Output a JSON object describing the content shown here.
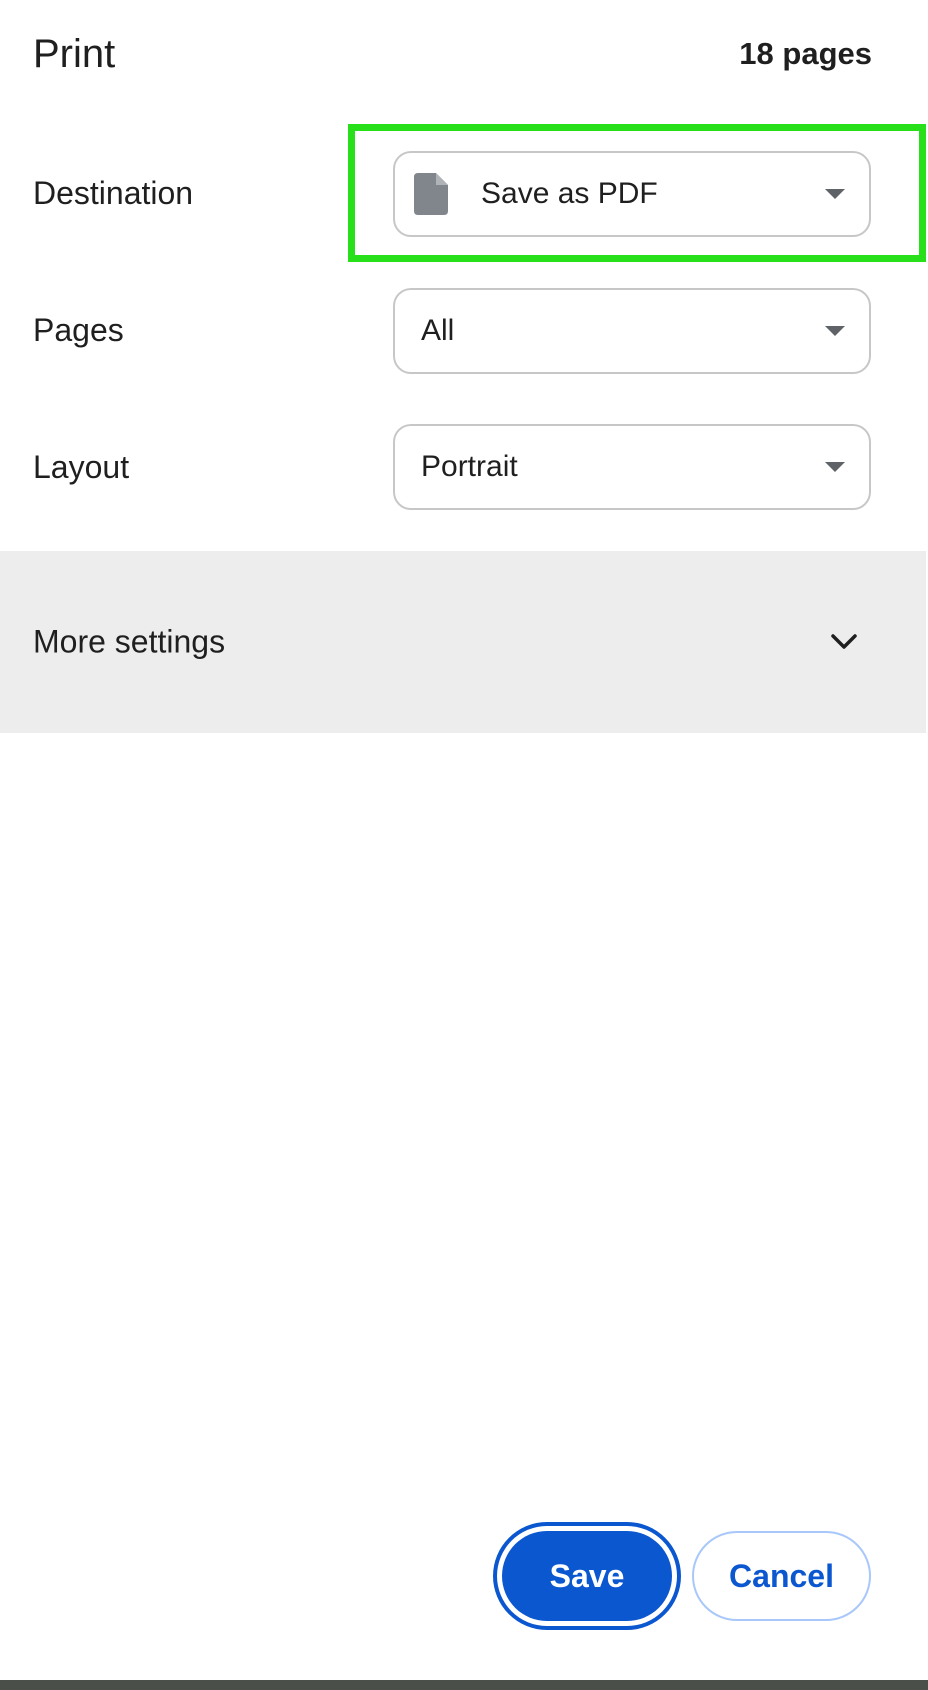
{
  "header": {
    "title": "Print",
    "page_count": "18 pages"
  },
  "destination": {
    "label": "Destination",
    "value": "Save as PDF",
    "icon": "file-icon"
  },
  "pages": {
    "label": "Pages",
    "value": "All"
  },
  "layout": {
    "label": "Layout",
    "value": "Portrait"
  },
  "more_settings": {
    "label": "More settings",
    "icon": "chevron-down-icon"
  },
  "actions": {
    "save_label": "Save",
    "cancel_label": "Cancel"
  },
  "colors": {
    "accent": "#0b57d0",
    "highlight": "#27e01a",
    "section_bg": "#ededed"
  }
}
